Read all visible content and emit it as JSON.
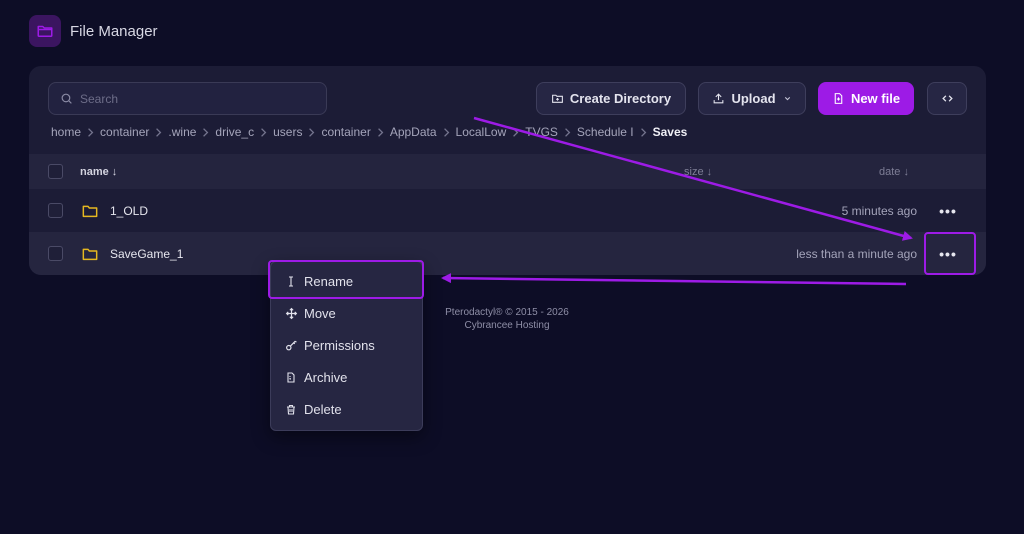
{
  "app": {
    "title": "File Manager",
    "logo_icon": "folder-icon"
  },
  "toolbar": {
    "search_placeholder": "Search",
    "create_directory": "Create Directory",
    "upload": "Upload",
    "new_file": "New file",
    "code_icon": "code-icon"
  },
  "breadcrumb": [
    "home",
    "container",
    ".wine",
    "drive_c",
    "users",
    "container",
    "AppData",
    "LocalLow",
    "TVGS",
    "Schedule I"
  ],
  "breadcrumb_current": "Saves",
  "table": {
    "headers": {
      "name": "name ↓",
      "size": "size ↓",
      "date": "date ↓"
    },
    "rows": [
      {
        "name": "1_OLD",
        "date": "5 minutes ago",
        "more": "•••"
      },
      {
        "name": "SaveGame_1",
        "date": "less than a minute ago",
        "more": "•••"
      }
    ]
  },
  "context_menu": {
    "items": [
      {
        "label": "Rename",
        "icon": "text-cursor-icon"
      },
      {
        "label": "Move",
        "icon": "move-arrows-icon"
      },
      {
        "label": "Permissions",
        "icon": "key-icon"
      },
      {
        "label": "Archive",
        "icon": "archive-icon"
      },
      {
        "label": "Delete",
        "icon": "trash-icon"
      }
    ]
  },
  "footer": {
    "line1": "Pterodactyl® © 2015 - 2026",
    "line2": "Cybrancee Hosting"
  },
  "colors": {
    "accent": "#9d1be6",
    "background": "#0d0d26",
    "panel": "#1c1c36",
    "folder": "#e6b820"
  }
}
